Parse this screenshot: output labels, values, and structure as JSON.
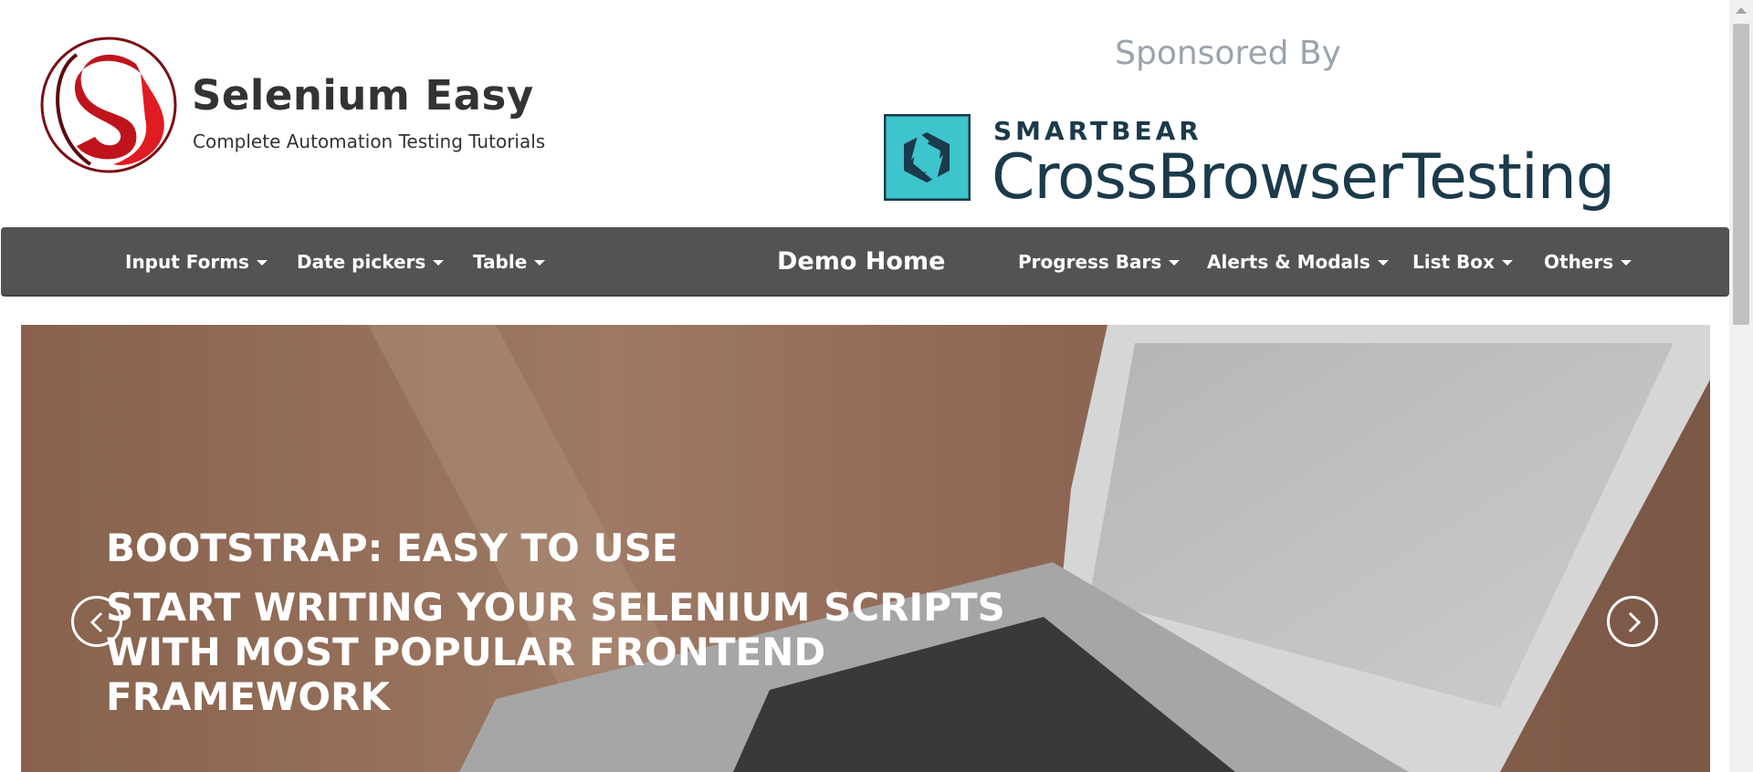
{
  "header": {
    "logo_title": "Selenium Easy",
    "logo_subtitle": "Complete Automation Testing Tutorials",
    "sponsor_label": "Sponsored By",
    "sponsor_company": "SMARTBEAR",
    "sponsor_product": "CrossBrowserTesting"
  },
  "navbar": {
    "brand": "Demo Home",
    "left_items": [
      {
        "label": "Input Forms"
      },
      {
        "label": "Date pickers"
      },
      {
        "label": "Table"
      }
    ],
    "right_items": [
      {
        "label": "Progress Bars"
      },
      {
        "label": "Alerts & Modals"
      },
      {
        "label": "List Box"
      },
      {
        "label": "Others"
      }
    ]
  },
  "carousel": {
    "heading": "Bootstrap: Easy to use",
    "text": "Start writing your Selenium Scripts with most popular Frontend Framework",
    "prev_icon": "chevron-left-icon",
    "next_icon": "chevron-right-icon"
  },
  "colors": {
    "navbar_bg": "#535353",
    "logo_red": "#c0141c",
    "cbt_teal": "#3ec4cc",
    "cbt_navy": "#1b3a4b"
  }
}
